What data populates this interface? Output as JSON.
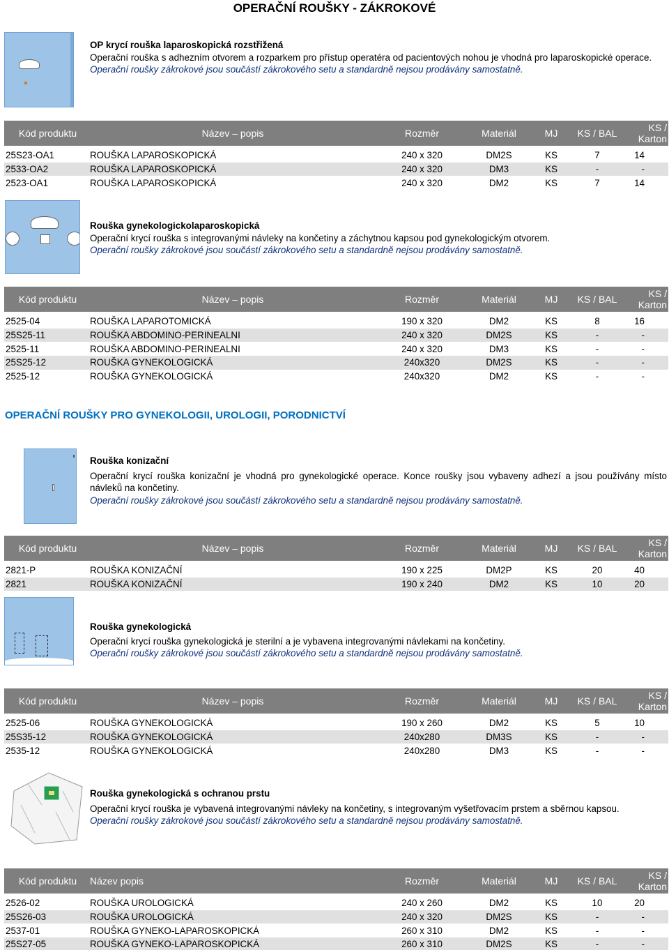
{
  "page_title": "OPERAČNÍ ROUŠKY - ZÁKROKOVÉ",
  "section2_title": "OPERAČNÍ ROUŠKY PRO GYNEKOLOGII, UROLOGII, PORODNICTVÍ",
  "headers": [
    "Kód produktu",
    "Název – popis",
    "Rozměr",
    "Materiál",
    "MJ",
    "KS / BAL",
    "KS / Karton"
  ],
  "headers_plain": [
    "Kód produktu",
    "Název popis",
    "Rozměr",
    "Materiál",
    "MJ",
    "KS / BAL",
    "KS / Karton"
  ],
  "note": "Operační roušky zákrokové jsou součástí zákrokového setu a standardně nejsou prodávány samostatně.",
  "products": [
    {
      "name": "OP krycí rouška laparoskopická rozstřižená",
      "desc": "Operační rouška s adhezním otvorem a rozparkem pro přístup operatéra od pacientových nohou je vhodná pro laparoskopické operace.",
      "rows": [
        [
          "25S23-OA1",
          "ROUŠKA LAPAROSKOPICKÁ",
          "240 x 320",
          "DM2S",
          "KS",
          "7",
          "14"
        ],
        [
          "2533-OA2",
          "ROUŠKA LAPAROSKOPICKÁ",
          "240 x 320",
          "DM3",
          "KS",
          "-",
          "-"
        ],
        [
          "2523-OA1",
          "ROUŠKA LAPAROSKOPICKÁ",
          "240 x 320",
          "DM2",
          "KS",
          "7",
          "14"
        ]
      ]
    },
    {
      "name": "Rouška gynekologickolaparoskopická",
      "desc": "Operační krycí rouška s integrovanými návleky na končetiny a záchytnou kapsou pod gynekologickým otvorem.",
      "rows": [
        [
          "2525-04",
          "ROUŠKA LAPAROTOMICKÁ",
          "190 x 320",
          "DM2",
          "KS",
          "8",
          "16"
        ],
        [
          "25S25-11",
          "ROUŠKA ABDOMINO-PERINEALNI",
          "240 x 320",
          "DM2S",
          "KS",
          "-",
          "-"
        ],
        [
          "2525-11",
          "ROUŠKA ABDOMINO-PERINEALNI",
          "240 x 320",
          "DM3",
          "KS",
          "-",
          "-"
        ],
        [
          "25S25-12",
          "ROUŠKA GYNEKOLOGICKÁ",
          "240x320",
          "DM2S",
          "KS",
          "-",
          "-"
        ],
        [
          "2525-12",
          "ROUŠKA GYNEKOLOGICKÁ",
          "240x320",
          "DM2",
          "KS",
          "-",
          "-"
        ]
      ]
    },
    {
      "name": "Rouška konizační",
      "desc": "Operační krycí rouška konizační je vhodná pro gynekologické operace. Konce roušky jsou vybaveny adhezí a jsou používány místo návleků na končetiny.",
      "rows": [
        [
          "2821-P",
          "ROUŠKA KONIZAČNÍ",
          "190 x 225",
          "DM2P",
          "KS",
          "20",
          "40"
        ],
        [
          "2821",
          "ROUŠKA KONIZAČNÍ",
          "190 x 240",
          "DM2",
          "KS",
          "10",
          "20"
        ]
      ]
    },
    {
      "name": "Rouška gynekologická",
      "desc": "Operační krycí rouška gynekologická je sterilní a je vybavena integrovanými návlekami na končetiny.",
      "rows": [
        [
          "2525-06",
          "ROUŠKA GYNEKOLOGICKÁ",
          "190 x 260",
          "DM2",
          "KS",
          "5",
          "10"
        ],
        [
          "25S35-12",
          "ROUŠKA GYNEKOLOGICKÁ",
          "240x280",
          "DM3S",
          "KS",
          "-",
          "-"
        ],
        [
          "2535-12",
          "ROUŠKA GYNEKOLOGICKÁ",
          "240x280",
          "DM3",
          "KS",
          "-",
          "-"
        ]
      ]
    },
    {
      "name": "Rouška gynekologická s ochranou prstu",
      "desc": "Operační krycí rouška je vybavená integrovanými návleky na končetiny, s integrovaným vyšetřovacím prstem a sběrnou kapsou.",
      "rows": [
        [
          "2526-02",
          "ROUŠKA UROLOGICKÁ",
          "240 x 260",
          "DM2",
          "KS",
          "10",
          "20"
        ],
        [
          "25S26-03",
          "ROUŠKA UROLOGICKÁ",
          "240 x 320",
          "DM2S",
          "KS",
          "-",
          "-"
        ],
        [
          "2537-01",
          "ROUŠKA GYNEKO-LAPAROSKOPICKÁ",
          "260 x 310",
          "DM2",
          "KS",
          "-",
          "-"
        ],
        [
          "25S27-05",
          "ROUŠKA GYNEKO-LAPAROSKOPICKÁ",
          "260 x 310",
          "DM2S",
          "KS",
          "-",
          "-"
        ]
      ]
    }
  ]
}
